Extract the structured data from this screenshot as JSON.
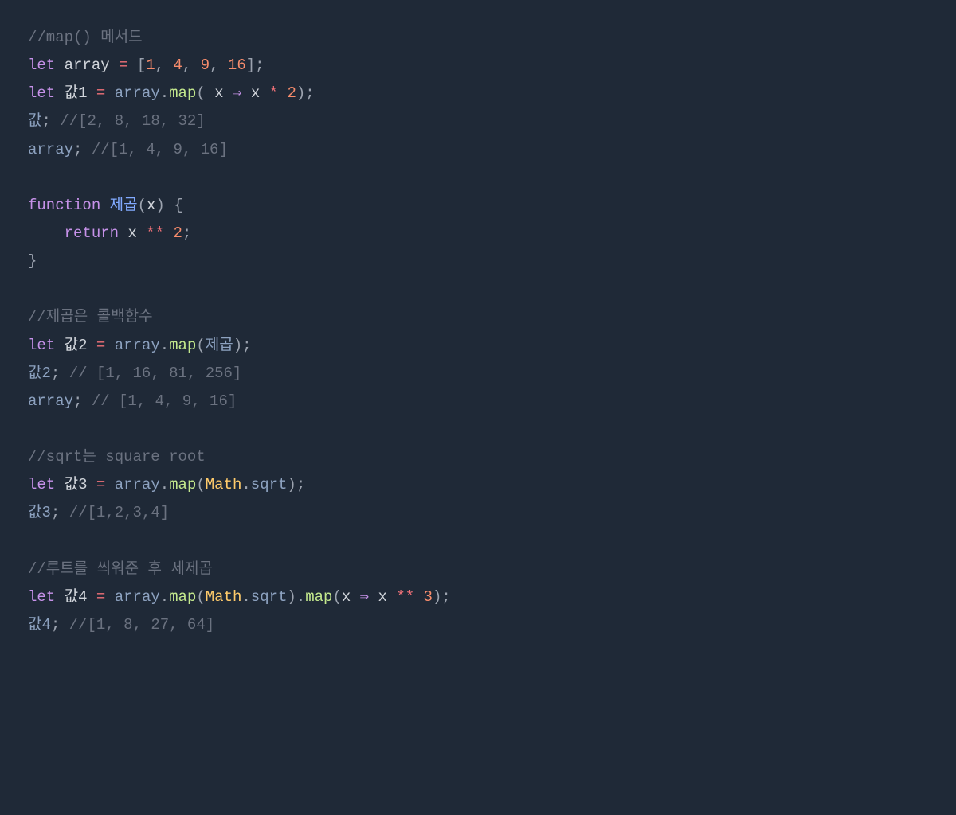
{
  "code": {
    "l1": {
      "comment": "//map() 메서드"
    },
    "l2": {
      "let": "let",
      "var": "array",
      "eq": "=",
      "br1": "[",
      "n1": "1",
      "c1": ",",
      "n2": "4",
      "c2": ",",
      "n3": "9",
      "c3": ",",
      "n4": "16",
      "br2": "]",
      "semi": ";"
    },
    "l3": {
      "let": "let",
      "var": "값1",
      "eq": "=",
      "arr": "array",
      "dot": ".",
      "method": "map",
      "p1": "(",
      "x1": "x",
      "arrow": "⇒",
      "x2": "x",
      "star": "*",
      "n": "2",
      "p2": ")",
      "semi": ";"
    },
    "l4": {
      "var": "값",
      "semi": ";",
      "comment": "//[2, 8, 18, 32]"
    },
    "l5": {
      "var": "array",
      "semi": ";",
      "comment": "//[1, 4, 9, 16]"
    },
    "l7": {
      "func": "function",
      "name": "제곱",
      "p1": "(",
      "x": "x",
      "p2": ")",
      "brace": "{"
    },
    "l8": {
      "indent": "    ",
      "return": "return",
      "x": "x",
      "op": "**",
      "n": "2",
      "semi": ";"
    },
    "l9": {
      "brace": "}"
    },
    "l11": {
      "comment": "//제곱은 콜백함수"
    },
    "l12": {
      "let": "let",
      "var": "값2",
      "eq": "=",
      "arr": "array",
      "dot": ".",
      "method": "map",
      "p1": "(",
      "cb": "제곱",
      "p2": ")",
      "semi": ";"
    },
    "l13": {
      "var": "값2",
      "semi": ";",
      "comment": "// [1, 16, 81, 256]"
    },
    "l14": {
      "var": "array",
      "semi": ";",
      "comment": "// [1, 4, 9, 16]"
    },
    "l16": {
      "comment": "//sqrt는 square root"
    },
    "l17": {
      "let": "let",
      "var": "값3",
      "eq": "=",
      "arr": "array",
      "dot": ".",
      "method": "map",
      "p1": "(",
      "math": "Math",
      "dot2": ".",
      "sqrt": "sqrt",
      "p2": ")",
      "semi": ";"
    },
    "l18": {
      "var": "값3",
      "semi": ";",
      "comment": "//[1,2,3,4]"
    },
    "l20": {
      "comment": "//루트를 씌워준 후 세제곱"
    },
    "l21": {
      "let": "let",
      "var": "값4",
      "eq": "=",
      "arr": "array",
      "dot": ".",
      "method": "map",
      "p1": "(",
      "math": "Math",
      "dot2": ".",
      "sqrt": "sqrt",
      "p2": ")",
      "dot3": ".",
      "method2": "map",
      "p3": "(",
      "x1": "x",
      "arrow": "⇒",
      "x2": "x",
      "op": "**",
      "n": "3",
      "p4": ")",
      "semi": ";"
    },
    "l22": {
      "var": "값4",
      "semi": ";",
      "comment": "//[1, 8, 27, 64]"
    }
  }
}
